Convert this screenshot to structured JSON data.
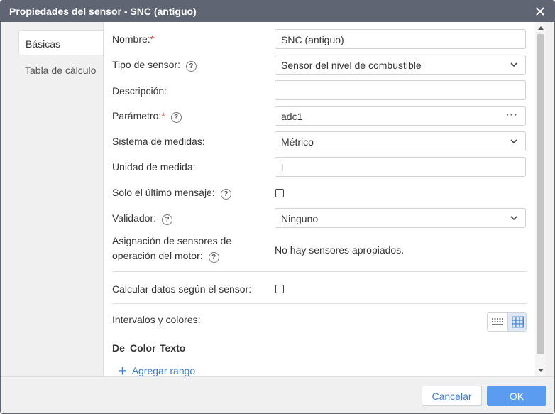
{
  "window": {
    "title": "Propiedades del sensor - SNC (antiguo)"
  },
  "tabs": [
    {
      "label": "Básicas",
      "active": true
    },
    {
      "label": "Tabla de cálculo",
      "active": false
    }
  ],
  "form": {
    "required_mark": "*",
    "help_glyph": "?",
    "name": {
      "label": "Nombre:",
      "value": "SNC (antiguo)"
    },
    "sensor_type": {
      "label": "Tipo de sensor:",
      "value": "Sensor del nivel de combustible"
    },
    "description": {
      "label": "Descripción:",
      "value": ""
    },
    "parameter": {
      "label": "Parámetro:",
      "value": "adc1",
      "more": "···"
    },
    "measurement_system": {
      "label": "Sistema de medidas:",
      "value": "Métrico"
    },
    "unit": {
      "label": "Unidad de medida:",
      "value": "l"
    },
    "last_message_only": {
      "label": "Solo el último mensaje:",
      "checked": false
    },
    "validator": {
      "label": "Validador:",
      "value": "Ninguno"
    },
    "engine_sensors": {
      "label_line1": "Asignación de sensores de",
      "label_line2": "operación del motor:",
      "value": "No hay sensores apropiados."
    },
    "calc_by_sensor": {
      "label": "Calcular datos según el sensor:",
      "checked": false
    },
    "intervals": {
      "label": "Intervalos y colores:"
    }
  },
  "ranges_table": {
    "columns": [
      "De",
      "Color",
      "Texto"
    ],
    "add_label": "Agregar rango",
    "add_glyph": "+"
  },
  "footer": {
    "cancel_label": "Cancelar",
    "ok_label": "OK"
  },
  "colors": {
    "titlebar": "#5f6573",
    "accent": "#3b7cd6",
    "ok_button": "#5b9cf0",
    "required": "#e53935"
  }
}
